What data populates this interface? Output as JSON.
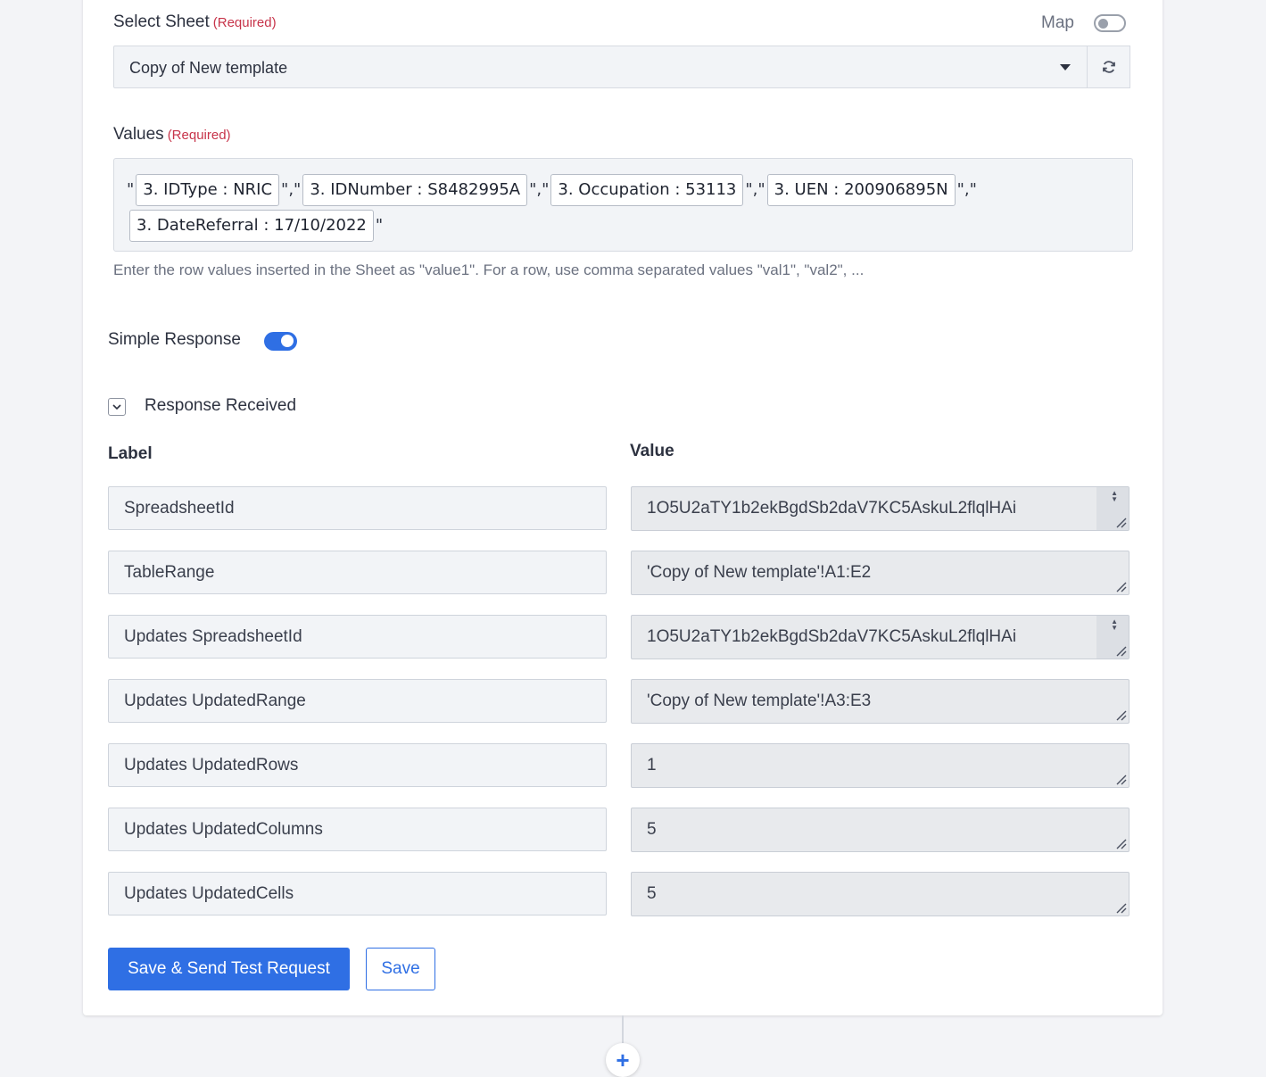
{
  "select_sheet": {
    "label": "Select Sheet",
    "required": "(Required)",
    "map_label": "Map",
    "map_enabled": false,
    "selected": "Copy of New template"
  },
  "values": {
    "label": "Values",
    "required": "(Required)",
    "tokens": [
      "3. IDType : NRIC",
      "3. IDNumber : S8482995A",
      "3. Occupation : 53113",
      "3. UEN : 200906895N",
      "3. DateReferral : 17/10/2022"
    ],
    "quote_open": "\"",
    "separator": "\",\"",
    "quote_close": "\"",
    "hint": "Enter the row values inserted in the Sheet as \"value1\". For a row, use comma separated values \"val1\", \"val2\", ..."
  },
  "simple_response": {
    "label": "Simple Response",
    "enabled": true
  },
  "response": {
    "title": "Response Received",
    "label_header": "Label",
    "value_header": "Value",
    "rows": [
      {
        "label": "SpreadsheetId",
        "value": "1O5U2aTY1b2ekBgdSb2daV7KC5AskuL2flqlHAi"
      },
      {
        "label": "TableRange",
        "value": "'Copy of New template'!A1:E2"
      },
      {
        "label": "Updates SpreadsheetId",
        "value": "1O5U2aTY1b2ekBgdSb2daV7KC5AskuL2flqlHAi"
      },
      {
        "label": "Updates UpdatedRange",
        "value": "'Copy of New template'!A3:E3"
      },
      {
        "label": "Updates UpdatedRows",
        "value": "1"
      },
      {
        "label": "Updates UpdatedColumns",
        "value": "5"
      },
      {
        "label": "Updates UpdatedCells",
        "value": "5"
      }
    ]
  },
  "buttons": {
    "save_send": "Save & Send Test Request",
    "save": "Save",
    "add_step": "+"
  },
  "colors": {
    "accent": "#2f6fe4",
    "required": "#c7344a"
  }
}
